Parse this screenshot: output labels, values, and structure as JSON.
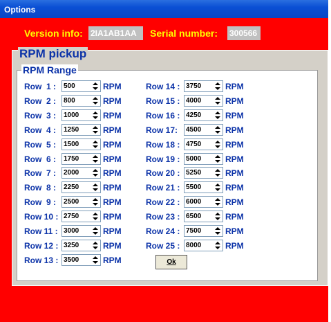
{
  "window": {
    "title": "Options"
  },
  "info": {
    "version_label": "Version info:",
    "version_value": "2IA1AB1AA",
    "serial_label": "Serial number:",
    "serial_value": "300566"
  },
  "panel": {
    "title": "RPM pickup",
    "range_title": "RPM Range"
  },
  "rows_left": [
    {
      "label": "Row  1 :",
      "value": "500"
    },
    {
      "label": "Row  2 :",
      "value": "800"
    },
    {
      "label": "Row  3 :",
      "value": "1000"
    },
    {
      "label": "Row  4 :",
      "value": "1250"
    },
    {
      "label": "Row  5 :",
      "value": "1500"
    },
    {
      "label": "Row  6 :",
      "value": "1750"
    },
    {
      "label": "Row  7 :",
      "value": "2000"
    },
    {
      "label": "Row  8 :",
      "value": "2250"
    },
    {
      "label": "Row  9 :",
      "value": "2500"
    },
    {
      "label": "Row 10 :",
      "value": "2750"
    },
    {
      "label": "Row 11 :",
      "value": "3000"
    },
    {
      "label": "Row 12 :",
      "value": "3250"
    },
    {
      "label": "Row 13 :",
      "value": "3500"
    }
  ],
  "rows_right": [
    {
      "label": "Row 14 :",
      "value": "3750"
    },
    {
      "label": "Row 15 :",
      "value": "4000"
    },
    {
      "label": "Row 16 :",
      "value": "4250"
    },
    {
      "label": "Row 17:",
      "value": "4500"
    },
    {
      "label": "Row 18 :",
      "value": "4750"
    },
    {
      "label": "Row 19 :",
      "value": "5000"
    },
    {
      "label": "Row 20 :",
      "value": "5250"
    },
    {
      "label": "Row 21 :",
      "value": "5500"
    },
    {
      "label": "Row 22 :",
      "value": "6000"
    },
    {
      "label": "Row 23 :",
      "value": "6500"
    },
    {
      "label": "Row 24 :",
      "value": "7500"
    },
    {
      "label": "Row 25 :",
      "value": "8000"
    }
  ],
  "unit": "RPM",
  "ok_label": "Ok",
  "icons": {
    "spin_up": "spin-up-icon",
    "spin_down": "spin-down-icon"
  },
  "colors": {
    "background": "#ff0000",
    "accent": "#ffff00",
    "label": "#0b32a8"
  }
}
